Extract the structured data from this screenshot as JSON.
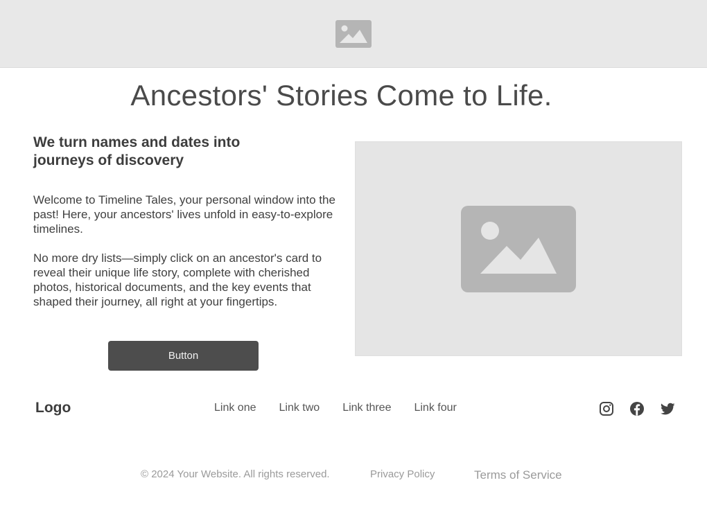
{
  "hero": {
    "image_icon": "image-placeholder-icon"
  },
  "main": {
    "title": "Ancestors' Stories Come to Life.",
    "subheading": "We turn names and dates into journeys of discovery",
    "paragraph_1": "Welcome to Timeline Tales, your personal window into the past! Here, your ancestors' lives unfold in easy-to-explore timelines.",
    "paragraph_2": "No more dry lists—simply click on an ancestor's card to reveal their unique life story, complete with cherished photos, historical documents, and the key events that shaped their journey, all right at your fingertips.",
    "button_label": "Button",
    "media_icon": "image-placeholder-icon"
  },
  "footer": {
    "logo": "Logo",
    "links": [
      "Link one",
      "Link two",
      "Link three",
      "Link four"
    ],
    "social_icons": [
      "instagram-icon",
      "facebook-icon",
      "twitter-icon"
    ],
    "copyright": "© 2024 Your Website. All rights reserved.",
    "privacy": "Privacy Policy",
    "terms": "Terms of Service"
  },
  "colors": {
    "placeholder_bg": "#e8e8e8",
    "placeholder_icon": "#b5b5b5",
    "button_bg": "#4d4d4d",
    "text": "#444444",
    "muted_text": "#9a9a9a"
  }
}
